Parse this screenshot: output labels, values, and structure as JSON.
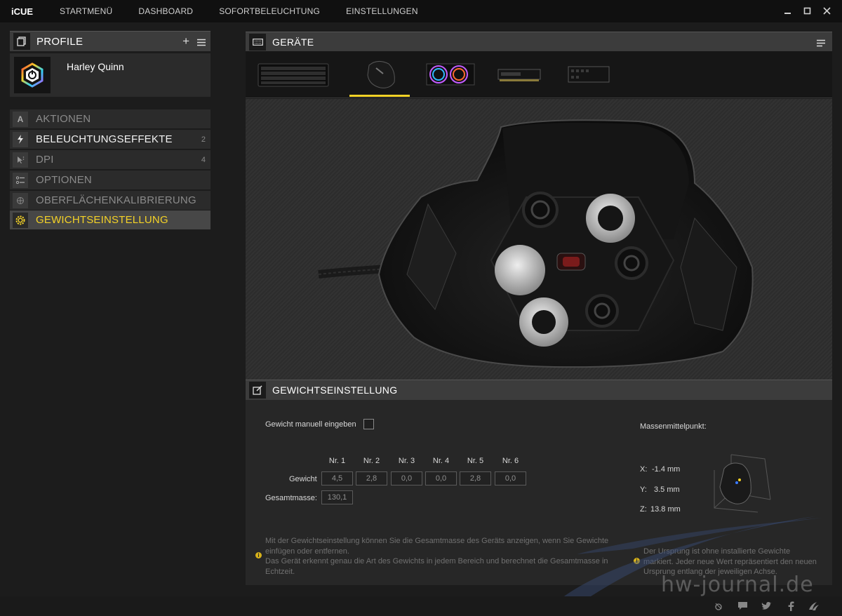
{
  "app": {
    "name": "iCUE"
  },
  "nav": [
    "STARTMENÜ",
    "DASHBOARD",
    "SOFORTBELEUCHTUNG",
    "EINSTELLUNGEN"
  ],
  "profile": {
    "title": "PROFILE",
    "name": "Harley Quinn"
  },
  "menu": [
    {
      "label": "AKTIONEN",
      "count": ""
    },
    {
      "label": "BELEUCHTUNGSEFFEKTE",
      "count": "2"
    },
    {
      "label": "DPI",
      "count": "4"
    },
    {
      "label": "OPTIONEN",
      "count": ""
    },
    {
      "label": "OBERFLÄCHENKALIBRIERUNG",
      "count": ""
    },
    {
      "label": "GEWICHTSEINSTELLUNG",
      "count": ""
    }
  ],
  "devices": {
    "title": "GERÄTE"
  },
  "weight": {
    "title": "GEWICHTSEINSTELLUNG",
    "manual_label": "Gewicht manuell eingeben",
    "columns": [
      "Nr. 1",
      "Nr. 2",
      "Nr. 3",
      "Nr. 4",
      "Nr. 5",
      "Nr. 6"
    ],
    "row_label": "Gewicht",
    "values": [
      "4,5",
      "2,8",
      "0,0",
      "0,0",
      "2,8",
      "0,0"
    ],
    "total_label": "Gesamtmasse:",
    "total_value": "130,1",
    "center_title": "Massenmittelpunkt:",
    "x": {
      "label": "X:",
      "value": "-1.4 mm"
    },
    "y": {
      "label": "Y:",
      "value": "3.5 mm"
    },
    "z": {
      "label": "Z:",
      "value": "13.8 mm"
    },
    "info_left_1": "Mit der Gewichtseinstellung können Sie die Gesamtmasse des Geräts anzeigen, wenn Sie Gewichte",
    "info_left_2": "einfügen oder entfernen.",
    "info_left_3": "Das Gerät erkennt genau die Art des Gewichts in jedem Bereich und berechnet die Gesamtmasse in",
    "info_left_4": "Echtzeit.",
    "info_right_1": "Der Ursprung ist ohne installierte Gewichte",
    "info_right_2": "markiert. Jeder neue Wert repräsentiert den neuen",
    "info_right_3": "Ursprung entlang der jeweiligen Achse."
  },
  "watermark": "hw-journal.de",
  "colors": {
    "accent": "#f4d227"
  }
}
